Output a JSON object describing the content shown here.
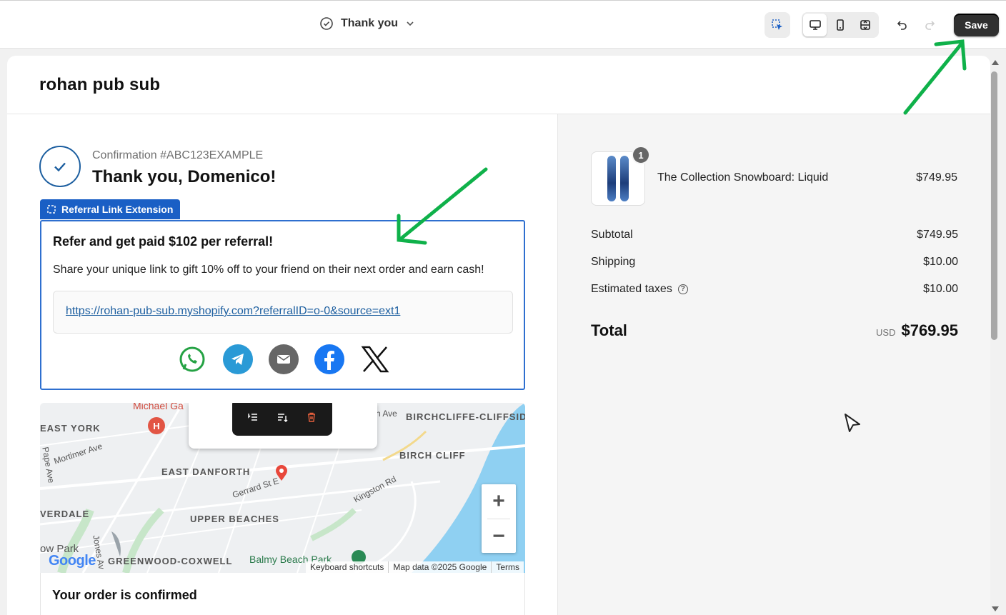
{
  "topbar": {
    "page_title": "Thank you",
    "save_label": "Save"
  },
  "shop": {
    "name": "rohan pub sub"
  },
  "confirmation": {
    "number": "Confirmation #ABC123EXAMPLE",
    "thanks": "Thank you, Domenico!"
  },
  "extension": {
    "tag_label": "Referral Link Extension",
    "title": "Refer and get paid $102 per referral!",
    "description": "Share your unique link to gift 10% off to your friend on their next order and earn cash!",
    "link": "https://rohan-pub-sub.myshopify.com?referralID=o-0&source=ext1",
    "share_icons": [
      "whatsapp-icon",
      "telegram-icon",
      "email-icon",
      "facebook-icon",
      "x-icon"
    ]
  },
  "map": {
    "labels": {
      "michael": "Michael Ga",
      "east_york": "EAST YORK",
      "birchcliffe": "BIRCHCLIFFE-CLIFFSID",
      "ave": "h Ave",
      "mortimer": "Mortimer Ave",
      "pape": "Pape Ave",
      "birch_cliff": "BIRCH CLIFF",
      "east_danforth": "EAST DANFORTH",
      "gerrard": "Gerrard St E",
      "kingston": "Kingston Rd",
      "riverdale": "VERDALE",
      "upper_beaches": "UPPER BEACHES",
      "low_park": "ow Park",
      "jones": "Jones Av",
      "greenwood": "GREENWOOD-COXWELL",
      "balmy": "Balmy Beach Park"
    },
    "google": "Google",
    "footer": [
      "Keyboard shortcuts",
      "Map data ©2025 Google",
      "Terms"
    ],
    "zoom_in": "+",
    "zoom_out": "−"
  },
  "order_confirmed": "Your order is confirmed",
  "summary": {
    "quantity": "1",
    "product_name": "The Collection Snowboard: Liquid",
    "product_price": "$749.95",
    "subtotal_label": "Subtotal",
    "subtotal_value": "$749.95",
    "shipping_label": "Shipping",
    "shipping_value": "$10.00",
    "taxes_label": "Estimated taxes",
    "taxes_value": "$10.00",
    "total_label": "Total",
    "currency": "USD",
    "total_value": "$769.95"
  },
  "colors": {
    "accent": "#1a5fc5",
    "annotation_arrow": "#0fb14a"
  }
}
